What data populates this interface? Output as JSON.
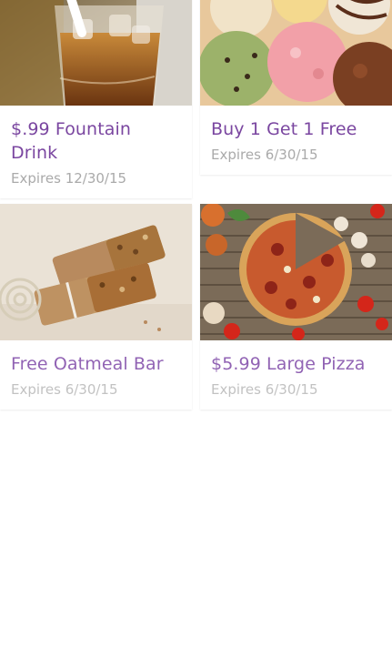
{
  "coupons": [
    {
      "title": "$.99 Fountain Drink",
      "expires": "Expires 12/30/15",
      "image_icon": "soda-glass-icon"
    },
    {
      "title": "Buy 1 Get 1 Free",
      "expires": "Expires 6/30/15",
      "image_icon": "ice-cream-scoops-icon"
    },
    {
      "title": "Free Oatmeal Bar",
      "expires": "Expires 6/30/15",
      "image_icon": "granola-bar-icon"
    },
    {
      "title": "$5.99 Large Pizza",
      "expires": "Expires 6/30/15",
      "image_icon": "pizza-icon"
    }
  ],
  "colors": {
    "title": "#7a46a0",
    "expires": "#aaaaaa",
    "background": "#ffffff"
  }
}
